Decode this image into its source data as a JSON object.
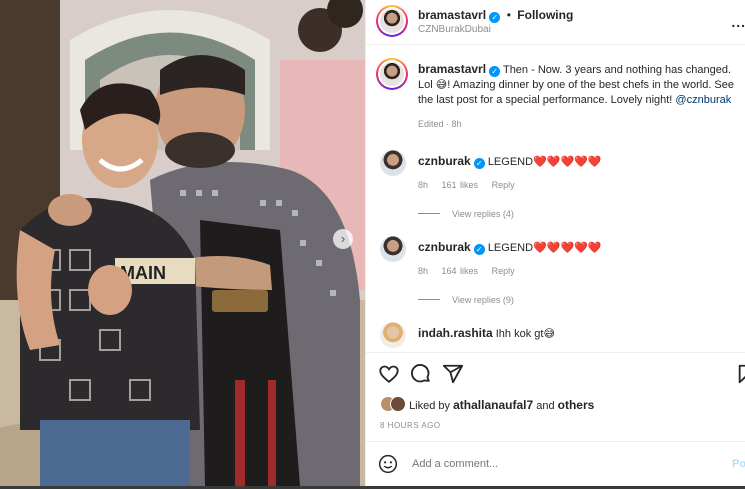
{
  "header": {
    "username": "bramastavrl",
    "follow_label": "Following",
    "location": "CZNBurakDubai",
    "more_label": "..."
  },
  "caption": {
    "username": "bramastavrl",
    "text_part1": "Then - Now. 3 years and nothing has changed. Lol ",
    "emoji1": "😅",
    "text_part2": "! Amazing dinner by one of the best chefs in the world. See the last post for a special performance. Lovely night! ",
    "mention": "@cznburak",
    "edited": "Edited · 8h"
  },
  "comments": [
    {
      "username": "cznburak",
      "text": "LEGEND",
      "hearts": "❤️❤️❤️❤️❤️",
      "time": "8h",
      "likes": "161 likes",
      "reply_label": "Reply",
      "view_replies": "View replies (4)"
    },
    {
      "username": "cznburak",
      "text": "LEGEND",
      "hearts": "❤️❤️❤️❤️❤️",
      "time": "8h",
      "likes": "164 likes",
      "reply_label": "Reply",
      "view_replies": "View replies (9)"
    },
    {
      "username": "indah.rashita",
      "text": "Ihh kok gt",
      "emoji": "😅"
    }
  ],
  "actions": {
    "icons": [
      "heart-icon",
      "comment-icon",
      "share-icon",
      "bookmark-icon"
    ]
  },
  "likes": {
    "prefix": "Liked by",
    "user": "athallanaufal7",
    "and": "and",
    "others": "others"
  },
  "timestamp": "8 HOURS AGO",
  "add_comment": {
    "placeholder": "Add a comment...",
    "post_label": "Po"
  },
  "photo": {
    "shirt_text": "MAIN"
  },
  "colors": {
    "verified": "#0095f6",
    "link": "#00376b",
    "post_disabled": "#b2dffc"
  }
}
